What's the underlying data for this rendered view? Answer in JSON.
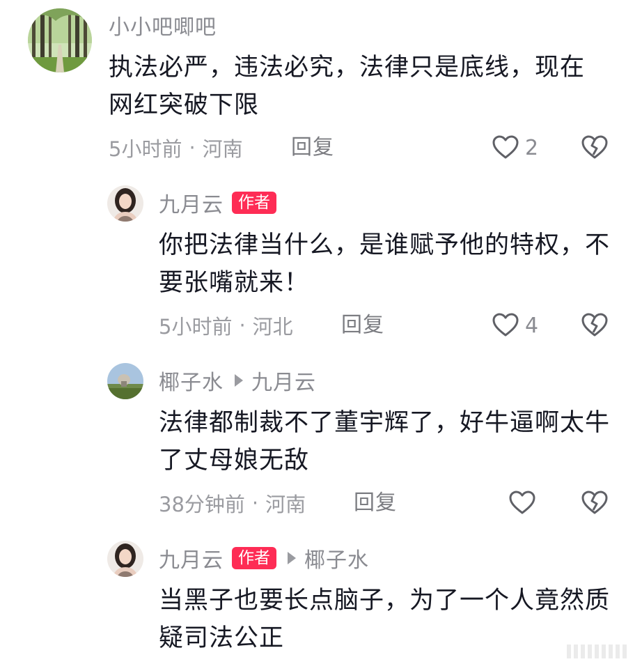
{
  "comments": [
    {
      "username": "小小吧唧吧",
      "author_badge": "",
      "reply_to": "",
      "text": "执法必严，违法必究，法律只是底线，现在网红突破下限",
      "time": "5小时前",
      "location": "河南",
      "reply_label": "回复",
      "likes": "2",
      "avatar": "forest-path"
    },
    {
      "username": "九月云",
      "author_badge": "作者",
      "reply_to": "",
      "text": "你把法律当什么，是谁赋予他的特权，不要张嘴就来！",
      "time": "5小时前",
      "location": "河北",
      "reply_label": "回复",
      "likes": "4",
      "avatar": "woman-portrait"
    },
    {
      "username": "椰子水",
      "author_badge": "",
      "reply_to": "九月云",
      "text": "法律都制裁不了董宇辉了，好牛逼啊太牛了丈母娘无敌",
      "time": "38分钟前",
      "location": "河南",
      "reply_label": "回复",
      "likes": "",
      "avatar": "landscape"
    },
    {
      "username": "九月云",
      "author_badge": "作者",
      "reply_to": "椰子水",
      "text": "当黑子也要长点脑子，为了一个人竟然质疑司法公正",
      "time": "",
      "location": "",
      "reply_label": "",
      "likes": "",
      "avatar": "woman-portrait"
    }
  ],
  "colors": {
    "author_badge_bg": "#fe2c55",
    "text": "#161823",
    "muted": "#8a8b91"
  }
}
